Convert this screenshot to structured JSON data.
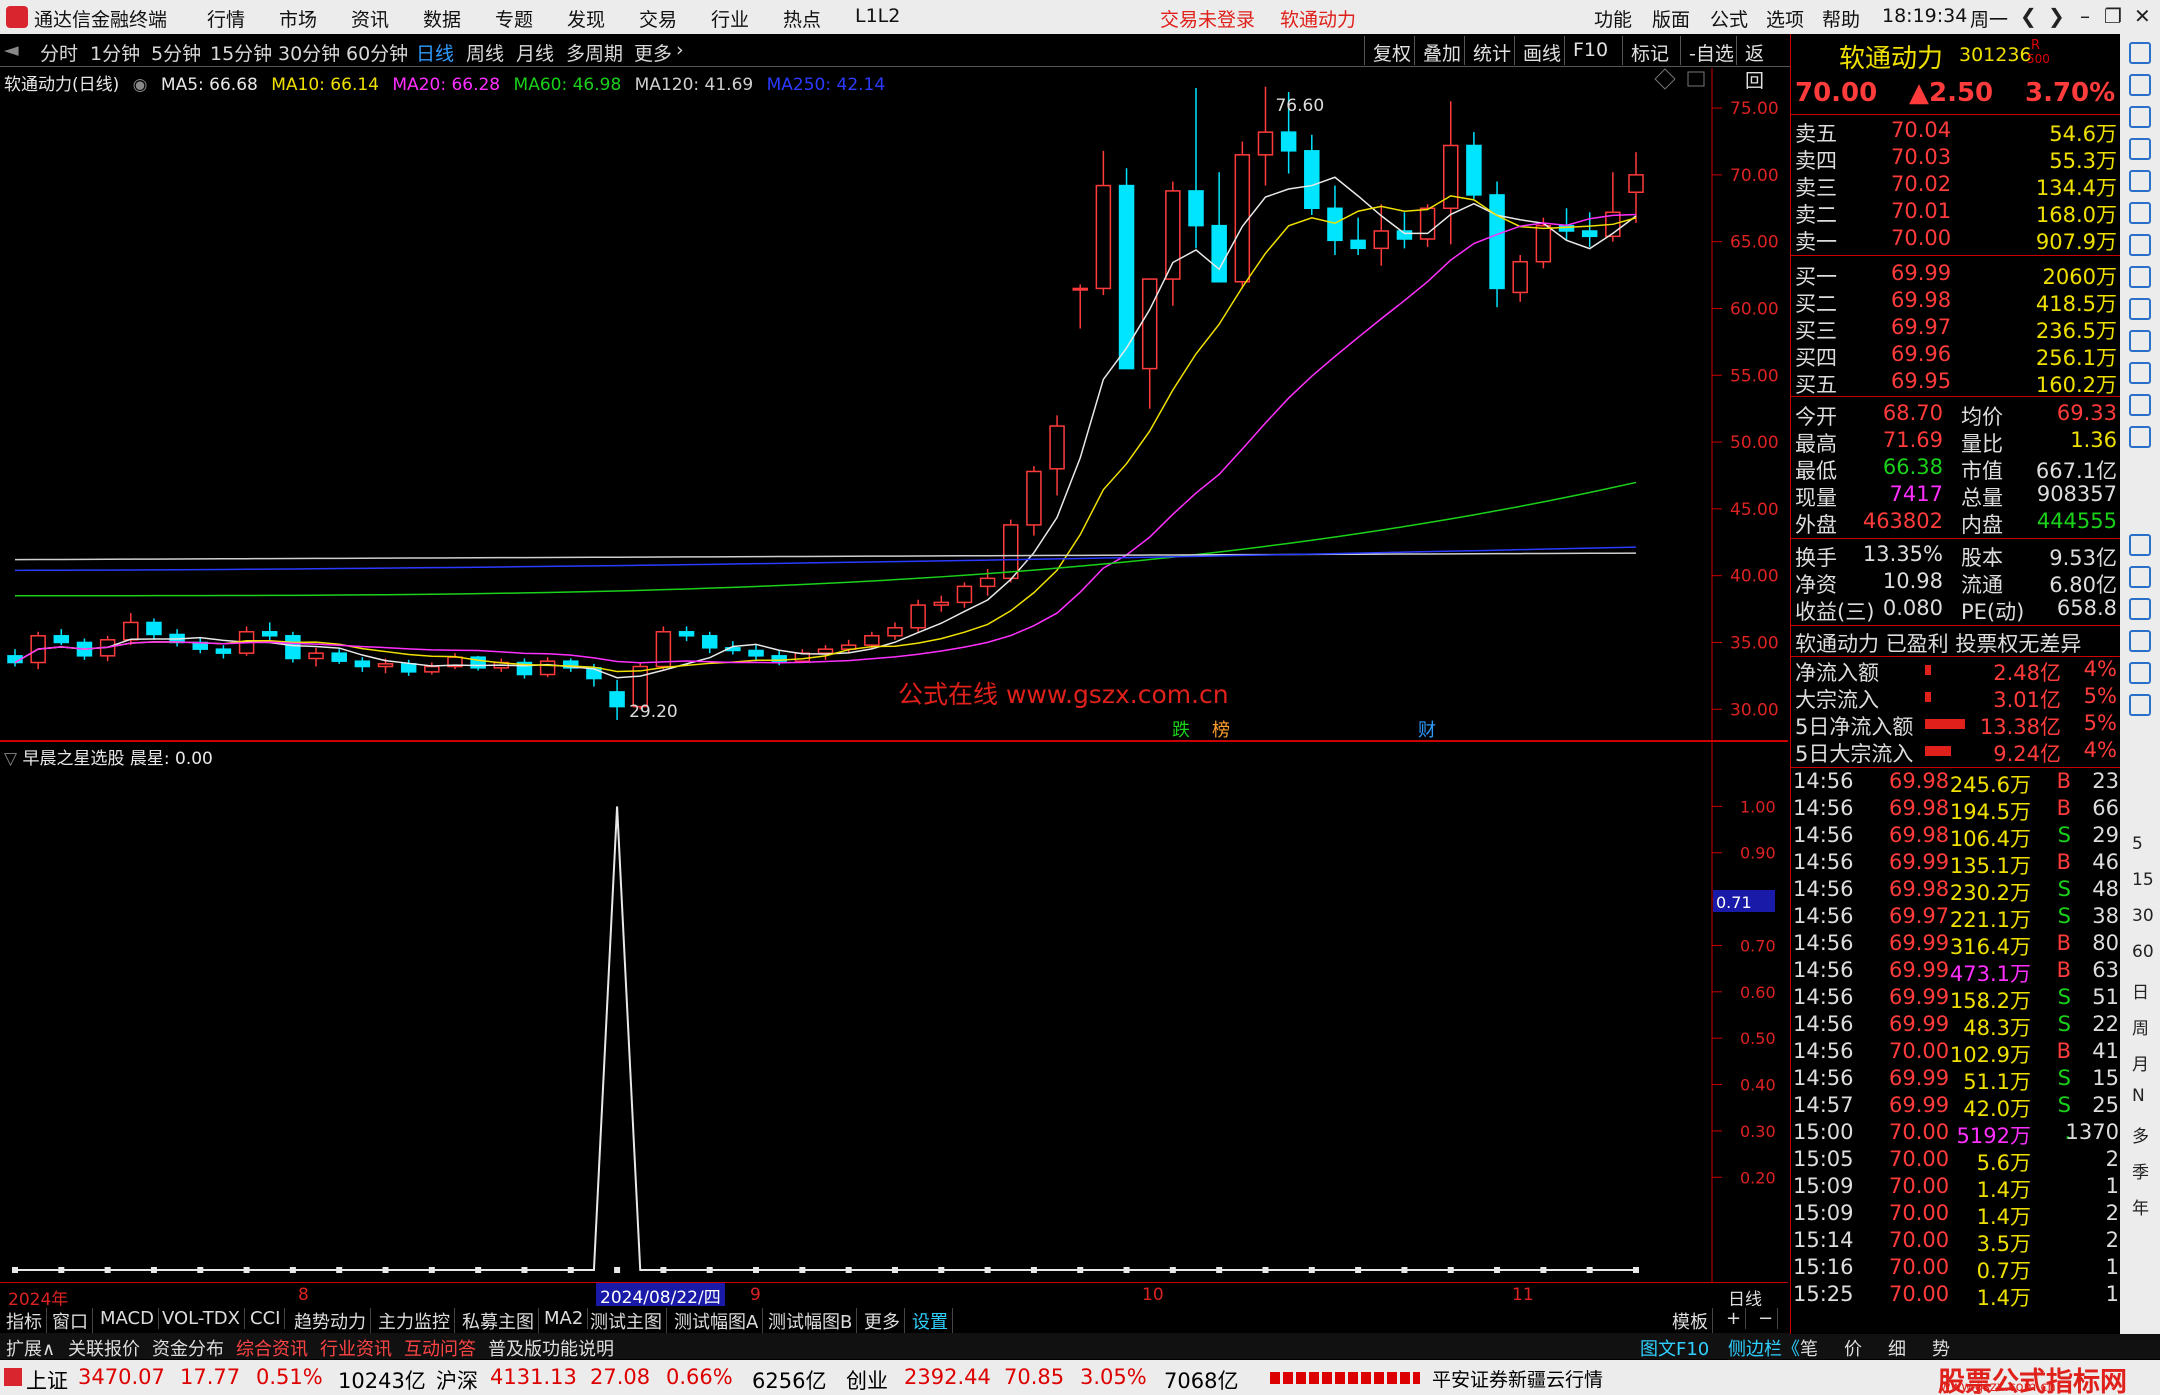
{
  "app": {
    "title": "通达信金融终端",
    "menus": [
      "行情",
      "市场",
      "资讯",
      "数据",
      "专题",
      "发现",
      "交易",
      "行业",
      "热点",
      "L1L2"
    ],
    "alert1": "交易未登录",
    "alert2": "软通动力",
    "right_menus": [
      "功能",
      "版面",
      "公式",
      "选项",
      "帮助"
    ],
    "clock": "18:19:34",
    "weekday": "周一"
  },
  "periods": [
    "分时",
    "1分钟",
    "5分钟",
    "15分钟",
    "30分钟",
    "60分钟",
    "日线",
    "周线",
    "月线",
    "多周期",
    "更多"
  ],
  "tools": [
    "复权",
    "叠加",
    "统计",
    "画线",
    "F10",
    "标记",
    "-自选",
    "返回"
  ],
  "chart_title": "软通动力(日线)",
  "ma": [
    {
      "label": "MA5: 66.68",
      "color": "#e8e8e8"
    },
    {
      "label": "MA10: 66.14",
      "color": "#f0e000"
    },
    {
      "label": "MA20: 66.28",
      "color": "#ff30ff"
    },
    {
      "label": "MA60: 46.98",
      "color": "#1ad11a"
    },
    {
      "label": "MA120: 41.69",
      "color": "#cfcfcf"
    },
    {
      "label": "MA250: 42.14",
      "color": "#2a3bff"
    }
  ],
  "price_axis": [
    "75.00",
    "70.00",
    "65.00",
    "60.00",
    "55.00",
    "50.00",
    "45.00",
    "40.00",
    "35.00",
    "30.00"
  ],
  "annotations": {
    "high": "76.60",
    "low": "29.20",
    "watermark": "公式在线  www.gszx.com.cn",
    "tags": [
      "跌",
      "榜",
      "财"
    ]
  },
  "chart_data": [
    {
      "type": "candlestick",
      "title": "软通动力(日线)",
      "ylim": [
        27.7,
        78
      ],
      "candles": [
        [
          34,
          34.5,
          33.2,
          33.5
        ],
        [
          33.5,
          35.8,
          33,
          35.5
        ],
        [
          35.5,
          36,
          34.8,
          35
        ],
        [
          35,
          35.3,
          33.7,
          34
        ],
        [
          34,
          35.5,
          33.6,
          35.2
        ],
        [
          35.2,
          37.2,
          34.8,
          36.5
        ],
        [
          36.5,
          36.8,
          35.2,
          35.6
        ],
        [
          35.6,
          36,
          34.7,
          35
        ],
        [
          35,
          35.4,
          34.2,
          34.5
        ],
        [
          34.5,
          34.8,
          33.8,
          34.2
        ],
        [
          34.2,
          36.2,
          34,
          35.8
        ],
        [
          35.8,
          36.5,
          35.1,
          35.5
        ],
        [
          35.5,
          35.8,
          33.5,
          33.8
        ],
        [
          33.8,
          34.6,
          33.2,
          34.2
        ],
        [
          34.2,
          34.5,
          33.4,
          33.6
        ],
        [
          33.6,
          33.9,
          32.8,
          33.2
        ],
        [
          33.2,
          33.8,
          32.7,
          33.4
        ],
        [
          33.4,
          33.7,
          32.5,
          32.8
        ],
        [
          32.8,
          33.5,
          32.6,
          33.2
        ],
        [
          33.2,
          34.2,
          33,
          33.9
        ],
        [
          33.9,
          34,
          32.9,
          33.1
        ],
        [
          33.1,
          33.8,
          32.8,
          33.5
        ],
        [
          33.5,
          33.8,
          32.3,
          32.6
        ],
        [
          32.6,
          33.9,
          32.4,
          33.6
        ],
        [
          33.6,
          33.8,
          32.8,
          33.1
        ],
        [
          33.1,
          33.4,
          31.7,
          32.3
        ],
        [
          31.3,
          32.2,
          29.2,
          30.2
        ],
        [
          30.2,
          33.5,
          30,
          33.2
        ],
        [
          33.2,
          36.2,
          33,
          35.8
        ],
        [
          35.8,
          36.2,
          35.1,
          35.5
        ],
        [
          35.5,
          35.8,
          34.2,
          34.6
        ],
        [
          34.6,
          35.1,
          34.1,
          34.4
        ],
        [
          34.4,
          34.8,
          33.6,
          34
        ],
        [
          34,
          34.4,
          33.3,
          33.6
        ],
        [
          33.6,
          34.5,
          33.5,
          34.2
        ],
        [
          34.2,
          34.8,
          33.7,
          34.5
        ],
        [
          34.5,
          35.2,
          34.2,
          34.8
        ],
        [
          34.8,
          35.8,
          34.5,
          35.5
        ],
        [
          35.5,
          36.5,
          35.2,
          36.1
        ],
        [
          36.1,
          38.2,
          35.8,
          37.8
        ],
        [
          37.8,
          38.5,
          37.3,
          38
        ],
        [
          38,
          39.5,
          37.6,
          39.2
        ],
        [
          39.2,
          40.5,
          38.5,
          39.8
        ],
        [
          39.8,
          44.2,
          39.5,
          43.8
        ],
        [
          43.8,
          48.2,
          43,
          47.8
        ],
        [
          48,
          52,
          46,
          51.2
        ],
        [
          61.5,
          61.8,
          58.5,
          61.5
        ],
        [
          61.5,
          71.8,
          61,
          69.2
        ],
        [
          69.2,
          70.5,
          55.8,
          55.5
        ],
        [
          55.5,
          61.5,
          52.5,
          62.2
        ],
        [
          62.2,
          69.5,
          60.2,
          68.8
        ],
        [
          68.8,
          76.5,
          64.5,
          66.2
        ],
        [
          66.2,
          70.2,
          62,
          62
        ],
        [
          62,
          72.5,
          61.5,
          71.5
        ],
        [
          71.5,
          76.6,
          69.2,
          73.2
        ],
        [
          73.2,
          76.2,
          70.1,
          71.8
        ],
        [
          71.8,
          73,
          67,
          67.5
        ],
        [
          67.5,
          69.2,
          64,
          65.1
        ],
        [
          65.1,
          66.8,
          64,
          64.5
        ],
        [
          64.5,
          67.8,
          63.2,
          65.8
        ],
        [
          65.8,
          67.2,
          64.5,
          65.2
        ],
        [
          65.2,
          67.8,
          64.6,
          67.5
        ],
        [
          67.5,
          75.5,
          64.8,
          72.2
        ],
        [
          72.2,
          73.2,
          68.2,
          68.5
        ],
        [
          68.5,
          69.5,
          60.1,
          61.5
        ],
        [
          61.2,
          64,
          60.5,
          63.5
        ],
        [
          63.5,
          66.8,
          63,
          66.2
        ],
        [
          66.2,
          67.5,
          65.1,
          65.8
        ],
        [
          65.8,
          67.2,
          64.6,
          65.4
        ],
        [
          65.4,
          70.2,
          65,
          67.2
        ],
        [
          68.7,
          71.7,
          66.4,
          70
        ]
      ]
    },
    {
      "type": "line",
      "title": "早晨之星选股 晨星: 0.00",
      "ylim": [
        0,
        1.1
      ],
      "y_ticks": [
        "1.00",
        "0.90",
        "0.80",
        "0.70",
        "0.60",
        "0.50",
        "0.40",
        "0.30",
        "0.20"
      ],
      "cursor_value": "0.71",
      "spike_index": 26,
      "points": 71
    }
  ],
  "sub_title": "早晨之星选股",
  "sub_value": "晨星: 0.00",
  "date_axis": {
    "year": "2024年",
    "m8": "8",
    "cursor": "2024/08/22/四",
    "m9": "9",
    "m10": "10",
    "m11": "11",
    "period": "日线"
  },
  "tabs1": [
    "指标",
    "窗口",
    "MACD",
    "VOL-TDX",
    "CCI",
    "趋势动力",
    "主力监控",
    "私募主图",
    "MA2",
    "测试主图",
    "测试幅图A",
    "测试幅图B",
    "更多",
    "设置"
  ],
  "tabs1_right": [
    "模板",
    "+",
    "−"
  ],
  "tabs2": [
    "扩展∧",
    "关联报价",
    "资金分布",
    "综合资讯",
    "行业资讯",
    "互动问答",
    "普及版功能说明"
  ],
  "tabs2_right": [
    "图文F10",
    "侧边栏《",
    "笔",
    "价",
    "细",
    "势"
  ],
  "status": {
    "sh_name": "上证",
    "sh": "3470.07",
    "sh_chg": "17.77",
    "sh_pct": "0.51%",
    "sh_amt": "10243亿",
    "hs_name": "沪深",
    "hs": "4131.13",
    "hs_chg": "27.08",
    "hs_pct": "0.66%",
    "hs_amt": "6256亿",
    "cy_name": "创业",
    "cy": "2392.44",
    "cy_chg": "70.85",
    "cy_pct": "3.05%",
    "cy_amt": "7068亿",
    "broker": "平安证券新疆云行情",
    "brand": "股票公式指标网",
    "brand_url": "www.gszx.com.cn"
  },
  "stock": {
    "name": "软通动力",
    "code": "301236",
    "mark": "R",
    "mark2": "500",
    "price": "70.00",
    "chg": "▲2.50",
    "pct": "3.70%"
  },
  "asks": [
    [
      "卖五",
      "70.04",
      "54.6万"
    ],
    [
      "卖四",
      "70.03",
      "55.3万"
    ],
    [
      "卖三",
      "70.02",
      "134.4万"
    ],
    [
      "卖二",
      "70.01",
      "168.0万"
    ],
    [
      "卖一",
      "70.00",
      "907.9万"
    ]
  ],
  "bids": [
    [
      "买一",
      "69.99",
      "2060万"
    ],
    [
      "买二",
      "69.98",
      "418.5万"
    ],
    [
      "买三",
      "69.97",
      "236.5万"
    ],
    [
      "买四",
      "69.96",
      "256.1万"
    ],
    [
      "买五",
      "69.95",
      "160.2万"
    ]
  ],
  "stats": [
    [
      "今开",
      "68.70",
      "均价",
      "69.33"
    ],
    [
      "最高",
      "71.69",
      "量比",
      "1.36"
    ],
    [
      "最低",
      "66.38",
      "市值",
      "667.1亿"
    ],
    [
      "现量",
      "7417",
      "总量",
      "908357"
    ],
    [
      "外盘",
      "463802",
      "内盘",
      "444555"
    ]
  ],
  "stats2": [
    [
      "换手",
      "13.35%",
      "股本",
      "9.53亿"
    ],
    [
      "净资",
      "10.98",
      "流通",
      "6.80亿"
    ],
    [
      "收益(三)",
      "0.080",
      "PE(动)",
      "658.8"
    ]
  ],
  "profile": "软通动力 已盈利 投票权无差异",
  "flows": [
    [
      "净流入额",
      "2.48亿",
      "4%"
    ],
    [
      "大宗流入",
      "3.01亿",
      "5%"
    ],
    [
      "5日净流入额",
      "13.38亿",
      "5%"
    ],
    [
      "5日大宗流入",
      "9.24亿",
      "4%"
    ]
  ],
  "ticks": [
    [
      "14:56",
      "69.98",
      "245.6万",
      "B",
      "23"
    ],
    [
      "14:56",
      "69.98",
      "194.5万",
      "B",
      "66"
    ],
    [
      "14:56",
      "69.98",
      "106.4万",
      "S",
      "29"
    ],
    [
      "14:56",
      "69.99",
      "135.1万",
      "B",
      "46"
    ],
    [
      "14:56",
      "69.98",
      "230.2万",
      "S",
      "48"
    ],
    [
      "14:56",
      "69.97",
      "221.1万",
      "S",
      "38"
    ],
    [
      "14:56",
      "69.99",
      "316.4万",
      "B",
      "80"
    ],
    [
      "14:56",
      "69.99",
      "473.1万",
      "B",
      "63"
    ],
    [
      "14:56",
      "69.99",
      "158.2万",
      "S",
      "51"
    ],
    [
      "14:56",
      "69.99",
      "48.3万",
      "S",
      "22"
    ],
    [
      "14:56",
      "70.00",
      "102.9万",
      "B",
      "41"
    ],
    [
      "14:56",
      "69.99",
      "51.1万",
      "S",
      "15"
    ],
    [
      "14:57",
      "69.99",
      "42.0万",
      "S",
      "25"
    ],
    [
      "15:00",
      "70.00",
      "5192万",
      ".",
      "1370"
    ],
    [
      "15:05",
      "70.00",
      "5.6万",
      "",
      "2"
    ],
    [
      "15:09",
      "70.00",
      "1.4万",
      "",
      "1"
    ],
    [
      "15:09",
      "70.00",
      "1.4万",
      "",
      "2"
    ],
    [
      "15:14",
      "70.00",
      "3.5万",
      "",
      "2"
    ],
    [
      "15:16",
      "70.00",
      "0.7万",
      "",
      "1"
    ],
    [
      "15:25",
      "70.00",
      "1.4万",
      "",
      "1"
    ]
  ],
  "side_text": [
    "5",
    "15",
    "30",
    "60",
    "日",
    "周",
    "月",
    "N",
    "多",
    "季",
    "年"
  ]
}
